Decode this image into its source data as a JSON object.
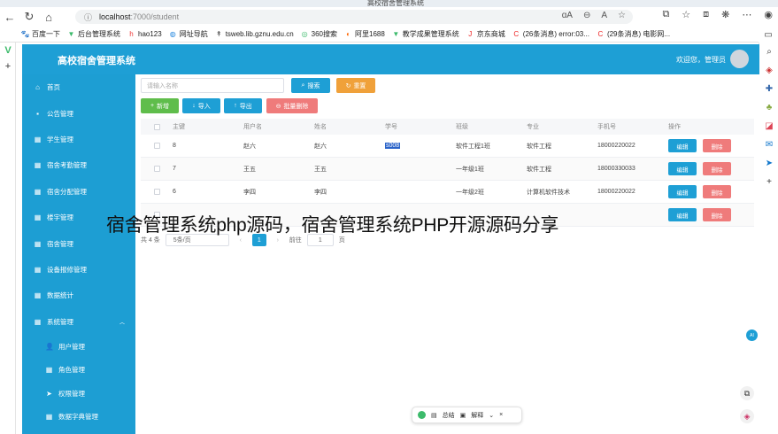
{
  "browser": {
    "tab_title": "高校宿舍管理系统",
    "url_host": "localhost",
    "url_path": ":7000/student",
    "bookmarks": [
      {
        "label": "百度一下",
        "icon": "paw-icon"
      },
      {
        "label": "后台管理系统",
        "icon": "v-logo-icon"
      },
      {
        "label": "hao123",
        "icon": "hao123-icon"
      },
      {
        "label": "网址导航",
        "icon": "globe-icon"
      },
      {
        "label": "tsweb.lib.gznu.edu.cn",
        "icon": "lib-icon"
      },
      {
        "label": "360搜索",
        "icon": "search-360-icon"
      },
      {
        "label": "阿里1688",
        "icon": "ali-icon"
      },
      {
        "label": "教学成果管理系统",
        "icon": "v-logo-icon"
      },
      {
        "label": "京东商城",
        "icon": "jd-icon"
      },
      {
        "label": "(26条消息) error:03...",
        "icon": "csdn-icon"
      },
      {
        "label": "(29条消息) 电影网...",
        "icon": "csdn-icon"
      }
    ]
  },
  "header": {
    "title": "高校宿舍管理系统",
    "welcome": "欢迎您，管理员"
  },
  "sidebar": {
    "items": [
      {
        "label": "首页",
        "icon": "home-icon"
      },
      {
        "label": "公告管理",
        "icon": "notice-icon"
      },
      {
        "label": "学生管理",
        "icon": "grid-icon"
      },
      {
        "label": "宿舍考勤管理",
        "icon": "grid-icon"
      },
      {
        "label": "宿舍分配管理",
        "icon": "grid-icon"
      },
      {
        "label": "楼宇管理",
        "icon": "grid-icon"
      },
      {
        "label": "宿舍管理",
        "icon": "grid-icon"
      },
      {
        "label": "设备报修管理",
        "icon": "grid-icon"
      },
      {
        "label": "数据统计",
        "icon": "grid-icon"
      },
      {
        "label": "系统管理",
        "icon": "apps-icon"
      }
    ],
    "sub_items": [
      {
        "label": "用户管理",
        "icon": "user-icon"
      },
      {
        "label": "角色管理",
        "icon": "grid-icon"
      },
      {
        "label": "权限管理",
        "icon": "send-icon"
      },
      {
        "label": "数据字典管理",
        "icon": "grid-icon"
      }
    ]
  },
  "toolbar": {
    "search_placeholder": "请输入名称",
    "search_label": "搜索",
    "reset_label": "重置",
    "add_label": "新增",
    "import_label": "导入",
    "export_label": "导出",
    "batch_delete_label": "批量删除"
  },
  "table": {
    "headers": [
      "主键",
      "用户名",
      "姓名",
      "学号",
      "班级",
      "专业",
      "手机号",
      "操作"
    ],
    "rows": [
      {
        "id": "8",
        "username": "赵六",
        "name": "赵六",
        "student_no": "s008",
        "class": "软件工程1班",
        "major": "软件工程",
        "phone": "18000220022"
      },
      {
        "id": "7",
        "username": "王五",
        "name": "王五",
        "student_no": "",
        "class": "一年级1班",
        "major": "软件工程",
        "phone": "18000330033"
      },
      {
        "id": "6",
        "username": "李四",
        "name": "李四",
        "student_no": "",
        "class": "一年级2班",
        "major": "计算机软件技术",
        "phone": "18000220022"
      },
      {
        "id": "",
        "username": "",
        "name": "",
        "student_no": "",
        "class": "",
        "major": "",
        "phone": ""
      }
    ],
    "edit_label": "编辑",
    "delete_label": "删除"
  },
  "pager": {
    "total": "共 4 条",
    "page_size": "5条/页",
    "current_page": "1",
    "goto_label": "前往",
    "goto_value": "1",
    "page_suffix": "页"
  },
  "overlay_caption": "宿舍管理系统php源码，宿舍管理系统PHP开源源码分享",
  "floatbar": {
    "summary_label": "总结",
    "explain_label": "解释"
  },
  "colors": {
    "primary": "#1e9fd5",
    "success": "#5fbd4b",
    "warning": "#f0a13a",
    "danger": "#ef7b7b"
  }
}
